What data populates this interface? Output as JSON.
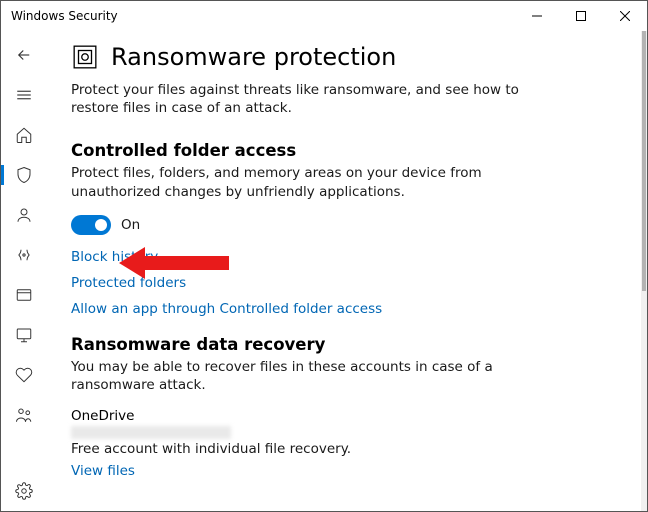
{
  "window": {
    "title": "Windows Security"
  },
  "page": {
    "title": "Ransomware protection",
    "description": "Protect your files against threats like ransomware, and see how to restore files in case of an attack."
  },
  "controlled_folder_access": {
    "heading": "Controlled folder access",
    "description": "Protect files, folders, and memory areas on your device from unauthorized changes by unfriendly applications.",
    "toggle_state_label": "On",
    "toggle_on": true,
    "link_block_history": "Block history",
    "link_protected_folders": "Protected folders",
    "link_allow_app": "Allow an app through Controlled folder access"
  },
  "data_recovery": {
    "heading": "Ransomware data recovery",
    "description": "You may be able to recover files in these accounts in case of a ransomware attack.",
    "account_name": "OneDrive",
    "account_desc": "Free account with individual file recovery.",
    "link_view_files": "View files"
  },
  "colors": {
    "accent": "#0078d4",
    "link": "#0066b4",
    "annotation_arrow": "#e81b1b"
  }
}
